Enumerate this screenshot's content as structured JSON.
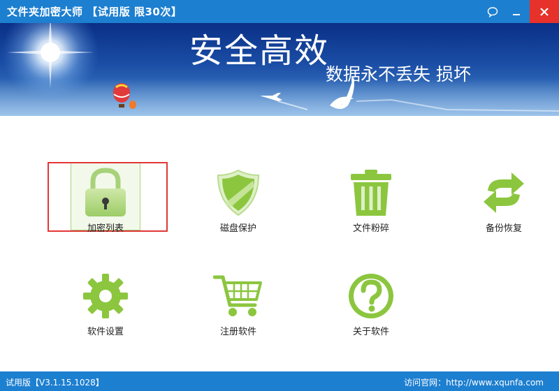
{
  "window": {
    "title": "文件夹加密大师 【试用版 限30次】",
    "feedback_icon": "chat-bubble-icon",
    "minimize_icon": "minimize-icon",
    "close_icon": "close-icon",
    "accent_color": "#1d7fd0",
    "close_color": "#e6322a"
  },
  "banner": {
    "headline": "安全高效",
    "subline": "数据永不丢失 损坏"
  },
  "features": [
    {
      "label": "加密列表",
      "icon": "padlock-icon",
      "selected": true
    },
    {
      "label": "磁盘保护",
      "icon": "shield-icon",
      "selected": false
    },
    {
      "label": "文件粉碎",
      "icon": "trash-bin-icon",
      "selected": false
    },
    {
      "label": "备份恢复",
      "icon": "sync-arrows-icon",
      "selected": false
    },
    {
      "label": "软件设置",
      "icon": "gear-icon",
      "selected": false
    },
    {
      "label": "注册软件",
      "icon": "shopping-cart-icon",
      "selected": false
    },
    {
      "label": "关于软件",
      "icon": "question-mark-icon",
      "selected": false
    }
  ],
  "status": {
    "left": "试用版【V3.1.15.1028】",
    "right": "访问官网：http://www.xqunfa.com"
  },
  "colors": {
    "icon_green": "#8cc63f",
    "highlight_red": "#e23636"
  }
}
